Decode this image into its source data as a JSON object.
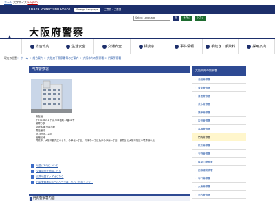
{
  "topbar": {
    "home": "ホーム",
    "text1": "文字サイズ",
    "english": "English"
  },
  "navy": {
    "brand": "Osaka Prefectural Police",
    "lang": "Foreign Language",
    "link": "ご意見・ご要望"
  },
  "header": {
    "title": "大阪府警察",
    "select_language": "Select Language",
    "btn1": "色",
    "btn2": "大きく",
    "btn3": "小さく",
    "search_placeholder": "Google 検索"
  },
  "menu": [
    "総合案内",
    "生活安全",
    "交通安全",
    "相談窓口",
    "事件情報",
    "手続き・手数料",
    "採用案内"
  ],
  "breadcrumb": {
    "now": "現在の位置",
    "path": "ホーム ＞ 組合案内 ＞ 大阪府下警察署等のご案内 ＞ 大阪市内の警察署 ＞ 門真警察署"
  },
  "page_title": "門真警察署",
  "info": [
    {
      "label": "所在地",
      "value": "〒571-8041 門真市幸福町13番14号"
    },
    {
      "label": "最寄り駅",
      "value": "京阪本線 門真市駅"
    },
    {
      "label": "電話番号",
      "value": "06-6906-1234"
    },
    {
      "label": "管轄区域",
      "value": "門真市、大阪市鶴見区のうち、今津北一丁目、今津中一丁目及び今津南一丁目、鶴見区と大阪市旭区の境界線以北"
    }
  ],
  "links": [
    "地図(PDF)について",
    "交番の所在地はこちら",
    "近隣地図マップはこちら",
    "門真警察署のホームページはこちら（外部リンク）"
  ],
  "sub_title": "門真警察署内図",
  "side": {
    "head": "大阪市外の警察署",
    "items": [
      "池田警察署",
      "豊能警察署",
      "箕面警察署",
      "茨木警察署",
      "摂津警察署",
      "吹田警察署",
      "高槻警察署",
      "門真警察署",
      "枚方警察署",
      "交野警察署",
      "寝屋川警察署",
      "四條畷警察署",
      "守口警察署",
      "大東警察署",
      "河内警察署"
    ]
  }
}
